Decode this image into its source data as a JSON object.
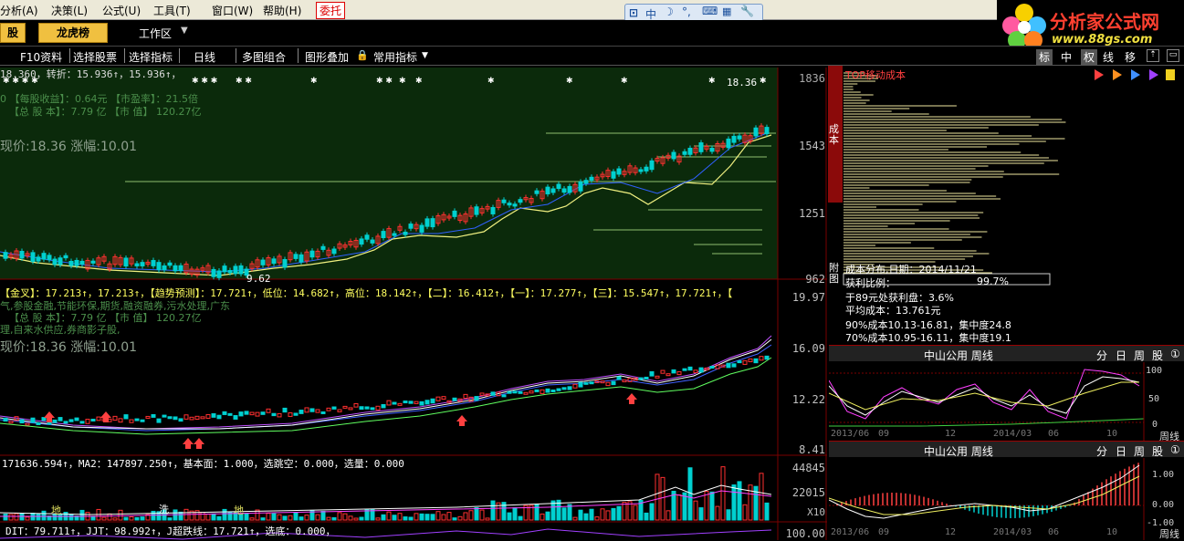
{
  "menubar": {
    "items": [
      "分析(A)",
      "决策(L)",
      "公式(U)",
      "工具(T)",
      "窗口(W)",
      "帮助(H)"
    ],
    "entrust_label": "委托"
  },
  "ime": {
    "zhong": "中",
    "moon": "☽",
    "dots": "°,",
    "kbd": "⌨",
    "tool": "🔧"
  },
  "logo": {
    "title": "分析家公式网",
    "url": "www.88gs.com"
  },
  "toolbar2": {
    "left_btn": "股",
    "longhu_btn": "龙虎榜",
    "workspace_label": "工作区"
  },
  "toolbar3": {
    "items": [
      "F10资料",
      "选择股票",
      "选择指标",
      "日线",
      "多图组合",
      "图形叠加",
      "常用指标"
    ],
    "right_tabs": [
      "标",
      "中",
      "权",
      "线",
      "移"
    ]
  },
  "main_chart": {
    "axis_labels": [
      "1836",
      "1543",
      "1251",
      "962"
    ],
    "header_line1": "18.360，转折：15.936↑，15.936↑，",
    "header_line2": "0 【每股收益】：0.64元 【市盈率】：21.5倍",
    "header_line3": "【总 股 本】：7.79 亿 【市 值】 120.27亿",
    "price_line": "现价:18.36 涨幅:10.01",
    "high_label": "18.36",
    "low_label": "9.62"
  },
  "sub_chart1": {
    "axis_labels": [
      "19.97",
      "16.09",
      "12.22",
      "8.41"
    ],
    "header": "【金叉】：17.213↑，17.213↑，【趋势预测】：17.721↑，低位：14.682↑，高位：18.142↑，【二】：16.412↑，【一】：17.277↑，【三】：15.547↑，17.721↑，【",
    "line2": "气,参股金融,节能环保,期货,融资融券,污水处理,广东",
    "line3": "【总 股 本】：7.79 亿 【市 值】 120.27亿",
    "line4": "理,自来水供应,券商影子股,",
    "price_line": "现价:18.36 涨幅:10.01"
  },
  "volume_chart": {
    "header": "171636.594↑，MA2：147897.250↑，基本面：1.000，选跳空：0.000，选量：0.000",
    "axis_labels": [
      "44845",
      "22015",
      "X10"
    ],
    "marker_labels": [
      "地",
      "洗",
      "地"
    ]
  },
  "indicator_chart": {
    "header": "DIT：79.711↑，JJT：98.992↑，J超跌线：17.721↑，选底：0.000，",
    "axis_label": "100.00"
  },
  "cost_panel": {
    "title": "TOP移动成本",
    "side_tab": "成本",
    "side_tab2": "附图",
    "date_line": "成本分布,日期：2014/11/21",
    "profit_label": "获利比例：",
    "profit_value": "99.7%",
    "line1": "于89元处获利盘：3.6%",
    "line2": "平均成本：13.761元",
    "line3": "90%成本10.13-16.81，集中度24.8",
    "line4": "70%成本10.95-16.11，集中度19.1"
  },
  "weekly_panel1": {
    "title": "中山公用 周线",
    "tabs": [
      "分",
      "日",
      "周",
      "股",
      "①"
    ],
    "axis_labels": [
      "100",
      "50",
      "0"
    ],
    "x_labels": [
      "2013/06",
      "09",
      "12",
      "2014/03",
      "06",
      "10"
    ],
    "corner": "周线"
  },
  "weekly_panel2": {
    "title": "中山公用 周线",
    "tabs": [
      "分",
      "日",
      "周",
      "股",
      "①"
    ],
    "axis_labels": [
      "1.00",
      "0.00",
      "-1.00"
    ],
    "x_labels": [
      "2013/06",
      "09",
      "12",
      "2014/03",
      "06",
      "10"
    ],
    "corner": "周线"
  },
  "colors": {
    "bg": "#000000",
    "chart_bg": "#0b2a0b",
    "grid_red": "#7a0000",
    "up": "#ff3030",
    "down": "#00d0d0",
    "yellow": "#ffff00"
  }
}
